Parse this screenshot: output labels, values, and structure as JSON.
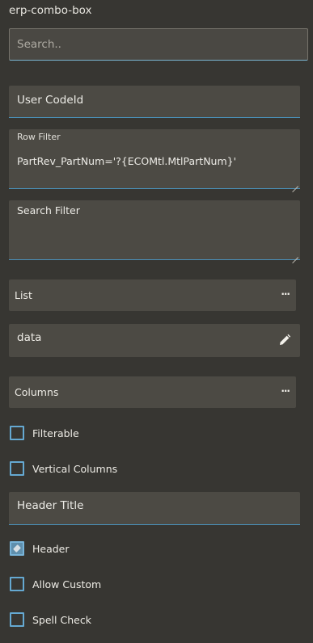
{
  "panel": {
    "title": "erp-combo-box"
  },
  "search": {
    "placeholder": "Search.."
  },
  "fields": {
    "user_code_id": "User CodeId",
    "row_filter_label": "Row Filter",
    "row_filter_value": "PartRev_PartNum='?{ECOMtl.MtlPartNum}'",
    "search_filter": "Search Filter",
    "header_title": "Header Title"
  },
  "sections": {
    "list": {
      "label": "List",
      "menu": "···"
    },
    "columns": {
      "label": "Columns",
      "menu": "···"
    }
  },
  "list_data": {
    "value": "data",
    "icon": "pencil-icon"
  },
  "checkboxes": [
    {
      "label": "Filterable",
      "checked": false
    },
    {
      "label": "Vertical Columns",
      "checked": false
    },
    {
      "label": "Header",
      "checked": true
    },
    {
      "label": "Allow Custom",
      "checked": false
    },
    {
      "label": "Spell Check",
      "checked": false
    }
  ],
  "colors": {
    "background": "#373632",
    "field": "#4c4a44",
    "accent": "#65a9d2"
  }
}
